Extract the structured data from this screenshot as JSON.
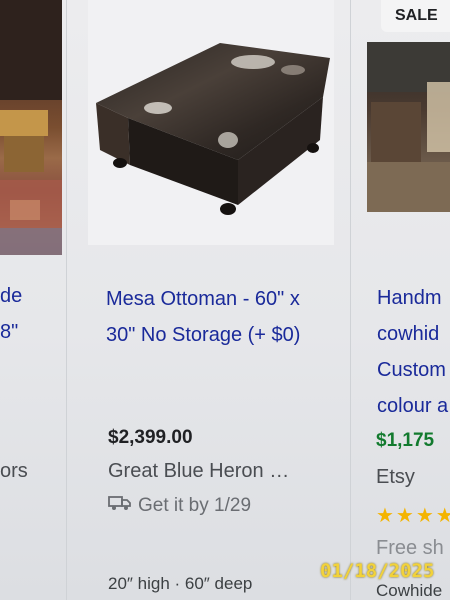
{
  "left_card": {
    "title_lines": [
      "de",
      "8\""
    ],
    "seller_fragment": "ors"
  },
  "main_card": {
    "title": "Mesa Ottoman - 60\" x 30\" No Storage (+ $0)",
    "price": "$2,399.00",
    "seller": "Great Blue Heron …",
    "delivery": "Get it by 1/29",
    "detail": "20″ high · 60″ deep"
  },
  "right_card": {
    "badge": "SALE",
    "title_lines": [
      "Handm",
      "cowhid",
      "Custom",
      "colour a"
    ],
    "price": "$1,175",
    "seller": "Etsy",
    "rating_stars": "★★★★",
    "shipping": "Free sh",
    "detail": "Cowhide"
  },
  "photo_stamp": "01/18/2025",
  "colors": {
    "link": "#1a2a9a",
    "price_green": "#127a2e",
    "stars": "#f4b400",
    "stamp": "#f2d23a"
  }
}
